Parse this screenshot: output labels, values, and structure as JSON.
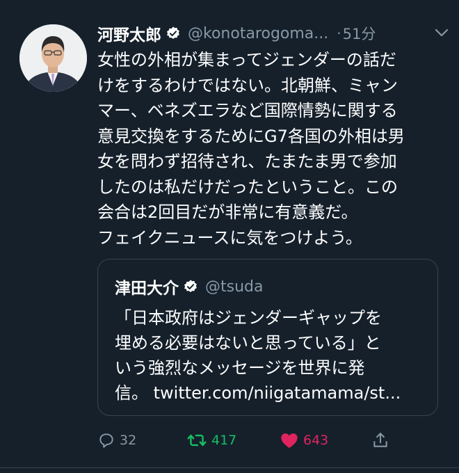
{
  "tweet": {
    "author_name": "河野太郎",
    "author_handle": "@konotarogoma...",
    "separator": "·",
    "time": "51分",
    "text": "女性の外相が集まってジェンダーの話だ\nけをするわけではない。北朝鮮、ミャン\nマー、ベネズエラなど国際情勢に関する\n意見交換をするためにG7各国の外相は男\n女を問わず招待され、たまたま男で参加\nしたのは私だけだったということ。この\n会合は2回目だが非常に有意義だ。\nフェイクニュースに気をつけよう。",
    "verified": true
  },
  "quoted": {
    "author_name": "津田大介",
    "author_handle": "@tsuda",
    "text": "「日本政府はジェンダーギャップを\n埋める必要はないと思っている」と\nいう強烈なメッセージを世界に発\n信。 twitter.com/niigatamama/st...",
    "verified": true
  },
  "actions": {
    "reply_count": "32",
    "retweet_count": "417",
    "like_count": "643"
  },
  "colors": {
    "background": "#15202b",
    "muted": "#8899a6",
    "retweet": "#17bf63",
    "like": "#e0245e",
    "verified": "#ffffff"
  },
  "icons": [
    "verified-badge-icon",
    "chevron-down-icon",
    "reply-icon",
    "retweet-icon",
    "heart-icon",
    "share-icon"
  ]
}
